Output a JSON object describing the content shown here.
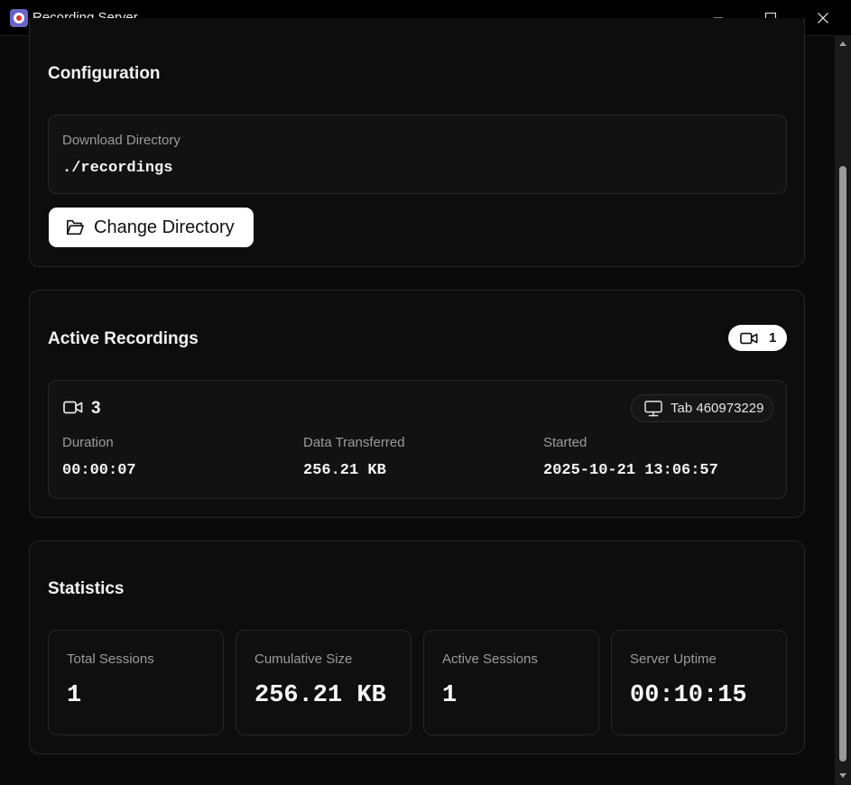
{
  "window": {
    "title": "Recording Server",
    "minimize_label": "—",
    "maximize_label": "☐",
    "close_label": "✕"
  },
  "configuration": {
    "title": "Configuration",
    "download_directory_label": "Download Directory",
    "download_directory_value": "./recordings",
    "change_directory_button": "Change Directory"
  },
  "active_recordings": {
    "title": "Active Recordings",
    "count_badge": "1",
    "recording": {
      "id": "3",
      "source": "Tab 460973229",
      "duration_label": "Duration",
      "duration_value": "00:00:07",
      "data_label": "Data Transferred",
      "data_value": "256.21 KB",
      "started_label": "Started",
      "started_value": "2025-10-21 13:06:57"
    }
  },
  "statistics": {
    "title": "Statistics",
    "items": [
      {
        "label": "Total Sessions",
        "value": "1"
      },
      {
        "label": "Cumulative Size",
        "value": "256.21 KB"
      },
      {
        "label": "Active Sessions",
        "value": "1"
      },
      {
        "label": "Server Uptime",
        "value": "00:10:15"
      }
    ]
  },
  "icons": {
    "app": "recording-app-icon",
    "folder": "folder-open-icon",
    "video": "video-camera-icon",
    "monitor": "monitor-icon"
  },
  "colors": {
    "background": "#0a0a0a",
    "card": "#0d0d0d",
    "border": "#272727",
    "accent_button": "#ffffff",
    "app_icon": "#6b64c7",
    "record_dot": "#d9302c"
  }
}
